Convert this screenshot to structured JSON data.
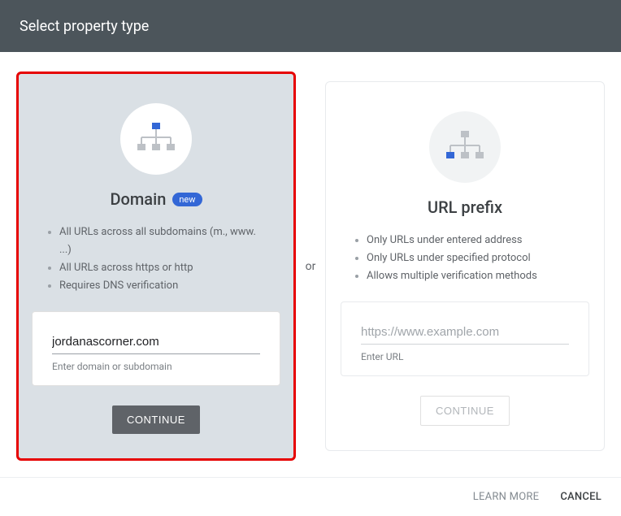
{
  "header": {
    "title": "Select property type"
  },
  "separator": "or",
  "left": {
    "title": "Domain",
    "badge": "new",
    "bullets": [
      "All URLs across all subdomains (m., www. ...)",
      "All URLs across https or http",
      "Requires DNS verification"
    ],
    "input_value": "jordanascorner.com",
    "helper": "Enter domain or subdomain",
    "button": "CONTINUE",
    "icon_accent": "#3367d6",
    "icon_box": "#bdc1c6"
  },
  "right": {
    "title": "URL prefix",
    "bullets": [
      "Only URLs under entered address",
      "Only URLs under specified protocol",
      "Allows multiple verification methods"
    ],
    "input_placeholder": "https://www.example.com",
    "helper": "Enter URL",
    "button": "CONTINUE",
    "icon_accent": "#3367d6",
    "icon_box": "#bdc1c6"
  },
  "footer": {
    "learn": "LEARN MORE",
    "cancel": "CANCEL"
  }
}
